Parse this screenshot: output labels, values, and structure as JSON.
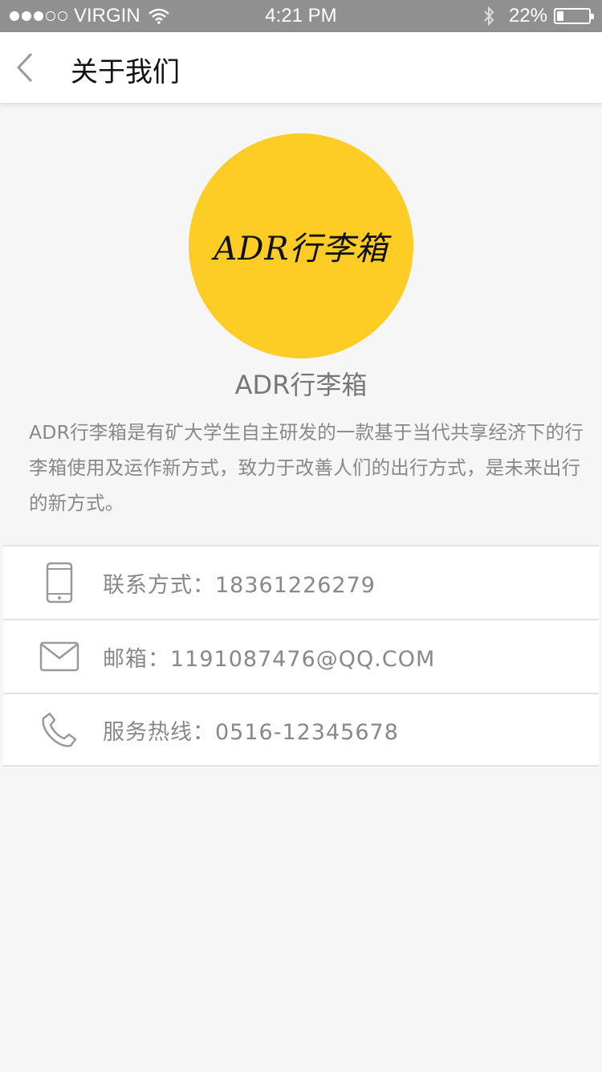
{
  "status_bar": {
    "carrier": "VIRGIN",
    "time": "4:21 PM",
    "battery": "22%",
    "battery_level": 0.22
  },
  "nav": {
    "title": "关于我们",
    "back_icon": "chevron-left-icon"
  },
  "logo": {
    "text": "ADR行李箱",
    "background": "#fdcd26"
  },
  "app_name": "ADR行李箱",
  "description": "ADR行李箱是有矿大学生自主研发的一款基于当代共享经济下的行李箱使用及运作新方式，致力于改善人们的出行方式，是未来出行的新方式。",
  "contacts": [
    {
      "icon": "phone-icon",
      "label": "联系方式：18361226279"
    },
    {
      "icon": "mail-icon",
      "label": "邮箱：1191087476@QQ.COM"
    },
    {
      "icon": "telephone-icon",
      "label": "服务热线：0516-12345678"
    }
  ]
}
